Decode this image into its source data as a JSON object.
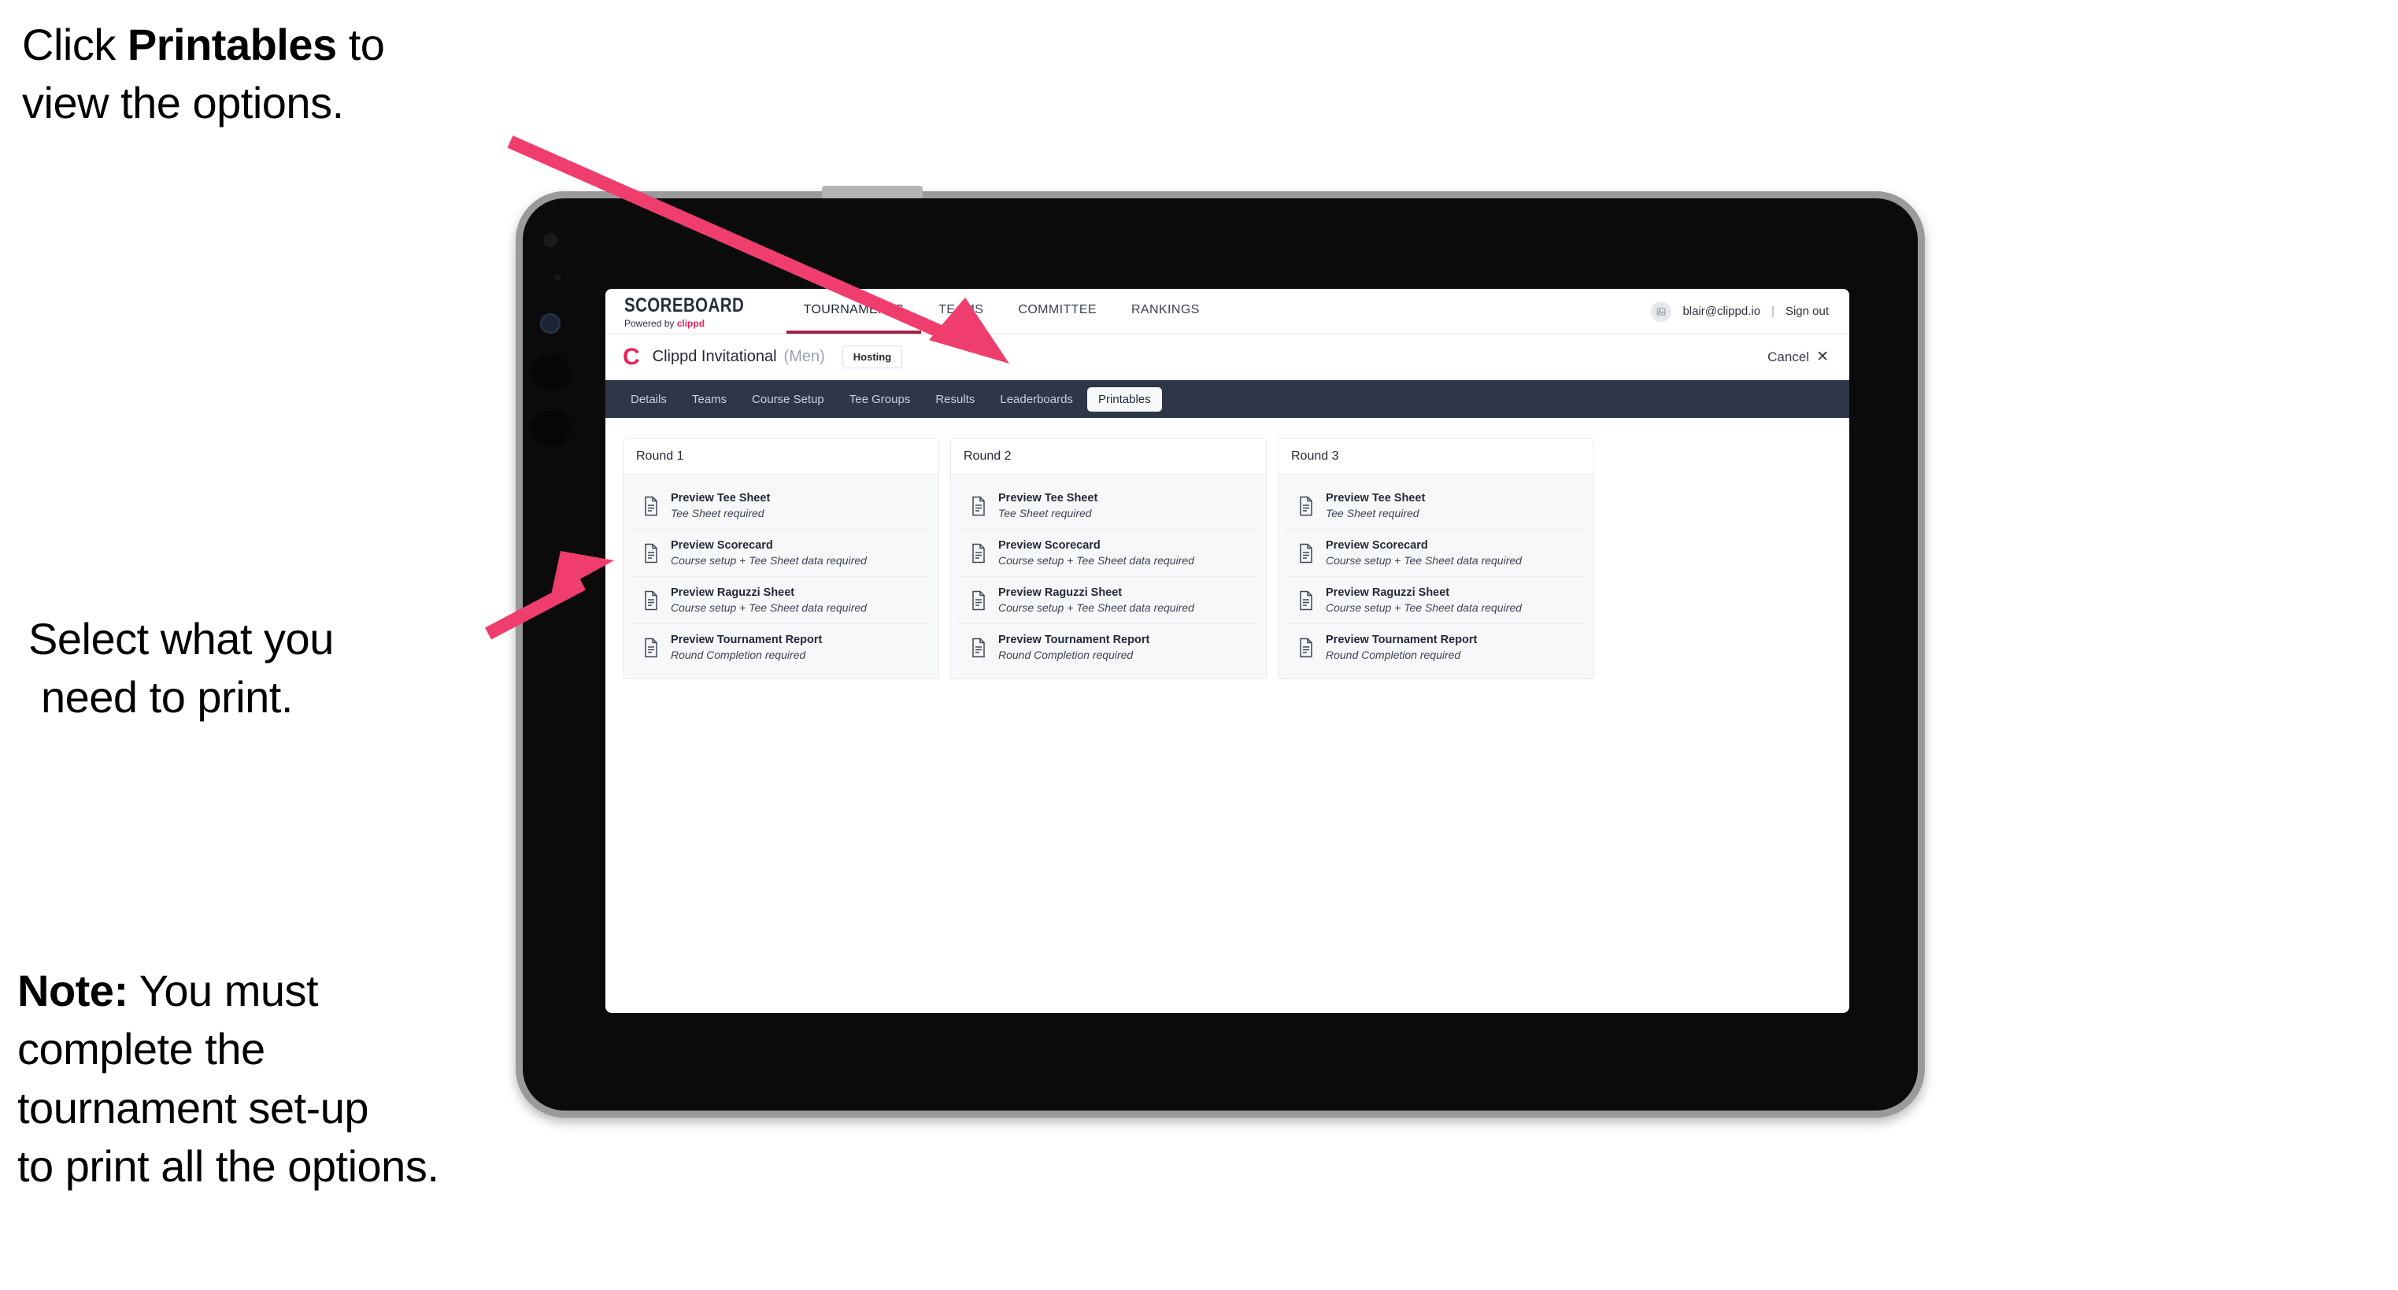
{
  "annotations": {
    "top": {
      "pre": "Click ",
      "bold": "Printables",
      "post": " to\nview the options."
    },
    "middle": {
      "line1": "Select what you",
      "line2": "need to print."
    },
    "note": {
      "bold": "Note:",
      "text": " You must\ncomplete the\ntournament set-up\nto print all the options."
    }
  },
  "colors": {
    "accent_pink": "#e8245c",
    "arrow_pink": "#ef3d6e",
    "navbar_navy": "#2d3748",
    "active_underline": "#a32243",
    "bezel_gray": "#9a9a9a"
  },
  "app": {
    "brand": {
      "title": "SCOREBOARD",
      "powered_prefix": "Powered by ",
      "powered_name": "clippd"
    },
    "top_nav": [
      {
        "label": "TOURNAMENTS",
        "active": true
      },
      {
        "label": "TEAMS",
        "active": false
      },
      {
        "label": "COMMITTEE",
        "active": false
      },
      {
        "label": "RANKINGS",
        "active": false
      }
    ],
    "account": {
      "avatar_icon": "user-avatar-icon",
      "email": "blair@clippd.io",
      "separator": "|",
      "sign_out": "Sign out"
    },
    "tournament_bar": {
      "logo_letter": "C",
      "name": "Clippd Invitational",
      "gender": "(Men)",
      "status_badge": "Hosting",
      "cancel_label": "Cancel",
      "cancel_icon": "close-x-icon"
    },
    "section_nav": [
      {
        "label": "Details",
        "active": false
      },
      {
        "label": "Teams",
        "active": false
      },
      {
        "label": "Course Setup",
        "active": false
      },
      {
        "label": "Tee Groups",
        "active": false
      },
      {
        "label": "Results",
        "active": false
      },
      {
        "label": "Leaderboards",
        "active": false
      },
      {
        "label": "Printables",
        "active": true
      }
    ],
    "rounds": [
      {
        "title": "Round 1",
        "items": [
          {
            "title": "Preview Tee Sheet",
            "sub": "Tee Sheet required"
          },
          {
            "title": "Preview Scorecard",
            "sub": "Course setup + Tee Sheet data required"
          },
          {
            "title": "Preview Raguzzi Sheet",
            "sub": "Course setup + Tee Sheet data required"
          },
          {
            "title": "Preview Tournament Report",
            "sub": "Round Completion required"
          }
        ]
      },
      {
        "title": "Round 2",
        "items": [
          {
            "title": "Preview Tee Sheet",
            "sub": "Tee Sheet required"
          },
          {
            "title": "Preview Scorecard",
            "sub": "Course setup + Tee Sheet data required"
          },
          {
            "title": "Preview Raguzzi Sheet",
            "sub": "Course setup + Tee Sheet data required"
          },
          {
            "title": "Preview Tournament Report",
            "sub": "Round Completion required"
          }
        ]
      },
      {
        "title": "Round 3",
        "items": [
          {
            "title": "Preview Tee Sheet",
            "sub": "Tee Sheet required"
          },
          {
            "title": "Preview Scorecard",
            "sub": "Course setup + Tee Sheet data required"
          },
          {
            "title": "Preview Raguzzi Sheet",
            "sub": "Course setup + Tee Sheet data required"
          },
          {
            "title": "Preview Tournament Report",
            "sub": "Round Completion required"
          }
        ]
      }
    ]
  }
}
